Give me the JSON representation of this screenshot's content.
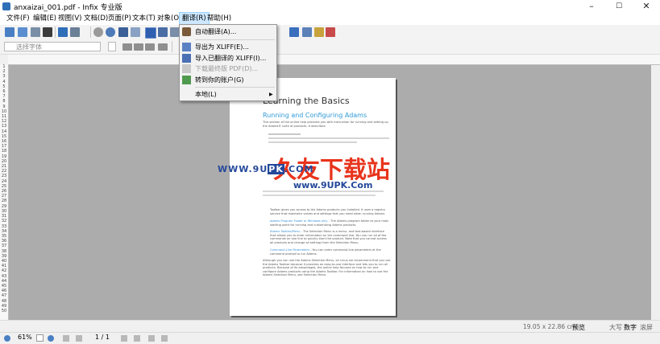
{
  "window": {
    "title": "anxaizai_001.pdf - Infix 专业版",
    "minimize": "–",
    "maximize": "☐",
    "close": "✕"
  },
  "menu": {
    "items": [
      {
        "label": "文件(F)"
      },
      {
        "label": "编辑(E)"
      },
      {
        "label": "视图(V)"
      },
      {
        "label": "文档(D)"
      },
      {
        "label": "页面(P)"
      },
      {
        "label": "文本(T)"
      },
      {
        "label": "对象(O)"
      },
      {
        "label": "翻译(R)"
      },
      {
        "label": "帮助(H)"
      }
    ],
    "active_index": 7
  },
  "toolbar2": {
    "font_placeholder": "选择字体"
  },
  "translate_menu": {
    "items": [
      {
        "label": "自动翻译(A)...",
        "icon": "auto-translate-icon",
        "enabled": true
      },
      {
        "label": "导出为 XLIFF(E)...",
        "icon": "export-xliff-icon",
        "enabled": true
      },
      {
        "label": "导入已翻译的 XLIFF(I)...",
        "icon": "import-xliff-icon",
        "enabled": true
      },
      {
        "label": "下载最终版 PDF(D)...",
        "icon": "download-pdf-icon",
        "enabled": false
      },
      {
        "label": "转到你的账户(G)",
        "icon": "home-account-icon",
        "enabled": true
      },
      {
        "label": "本地(L)",
        "icon": "",
        "enabled": true,
        "submenu_arrow": "▶"
      }
    ]
  },
  "document": {
    "heading": "Learning the Basics",
    "subheading": "Running and Configuring Adams",
    "intro": "This section of the online help provides you with instruction for running and setting up the Adams® suite of products. It describes:",
    "toolbar_para": "Toolbar gives you access to the Adams products you installed. It uses a registry service that maintains values and settings that you need when running Adams.",
    "bullets": [
      {
        "link": "Adams Program Folder or Windows only",
        "text": " - The Adams program folder at your main starting point for running and customizing Adams products."
      },
      {
        "link": "Adams Toolbar/Menu",
        "text": " - The Selection Menu is a menu- and text-based interface that allows you to enter information on the command line. You can run all of the commands on one line to quickly start the product. Note that you cannot access all products and change all settings from the Selection Menu."
      },
      {
        "link": "Command-Line Parameters",
        "text": " - You can enter command-line parameters at the command prompt to run Adams."
      }
    ],
    "closing": "Although you can use the Adams Selection Menu, on Linux we recommend that you use the Adams Toolbar because it provides an easy-to-use interface and lets you to run all products. Because of its advantages, the online help focuses on how to run and configure Adams products using the Adams Toolbar. For information on how to use the Adams Selection Menu, see Selection Menu."
  },
  "watermark": {
    "cn": "久友下载站",
    "url_left": "WWW.9U",
    "url_badge": "PK",
    "url_right": ".COM",
    "sub": "www.9UPK.Com"
  },
  "statusbar": {
    "zoom": "61%",
    "page": "1 / 1",
    "dimensions": "19.05 x 22.86 cm",
    "mode": "预览",
    "caps": "大写",
    "num": "数字",
    "scroll": "滚屏"
  },
  "colors": {
    "heading_blue": "#2f9ad6",
    "link_blue": "#3a8fd6",
    "menu_highlight": "#cde8ff",
    "workspace": "#acacac",
    "watermark_red": "#e8341c",
    "watermark_navy": "#24489a"
  }
}
